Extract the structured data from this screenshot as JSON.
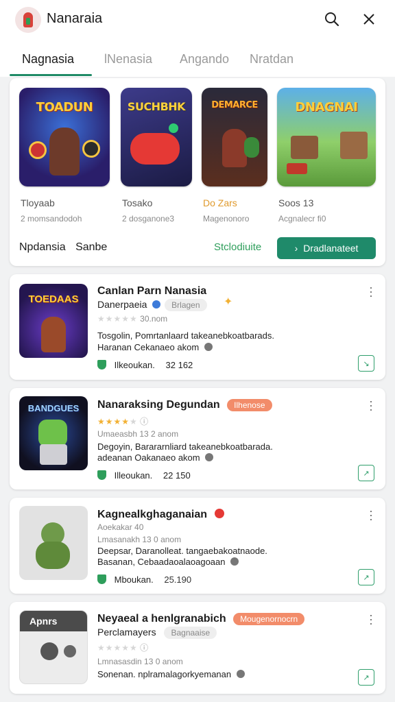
{
  "app": {
    "title": "Nanaraia"
  },
  "tabs": [
    {
      "label": "Nagnasia"
    },
    {
      "label": "lNenasia"
    },
    {
      "label": "Angando"
    },
    {
      "label": "Nratdan"
    }
  ],
  "featured": {
    "games": [
      {
        "art": "TOADUN",
        "name": "Tloyaab",
        "sub": "2 momsandodoh"
      },
      {
        "art": "SUCHBHK",
        "name": "Tosako",
        "sub": "2 dosganone3"
      },
      {
        "art": "DEMARCE",
        "name": "Do Zars",
        "sub": "Magenonoro"
      },
      {
        "art": "DNAGNAI",
        "name": "Soos 13",
        "sub": "Acgnalecr fi0"
      }
    ],
    "footer_a": "Npdansia",
    "footer_b": "Sanbe",
    "link": "Stclodiuite",
    "primary": "Dradlanateet"
  },
  "cards": [
    {
      "art": "TOEDAAS",
      "title": "Canlan Parn Nanasia",
      "subtitle": "Danerpaeia",
      "tag": "Brlagen",
      "meta": "30.nom",
      "desc1": "Tosgolin, Pomrtanlaard takeanebkoatbarads.",
      "desc2": "Haranan Cekanaeo akom",
      "stat": "Ilkeoukan.",
      "num": "32 162"
    },
    {
      "art": "BANDGUES",
      "title": "Nanaraksing Degundan",
      "subtitle": "",
      "tag": "Ilhenose",
      "meta": "Umaeasbh 13 2 anom",
      "desc1": "Degoyin, Barararnliard takeanebkoatbarada.",
      "desc2": "adeanan Oakanaeo akom",
      "stat": "Illeoukan.",
      "num": "22 150"
    },
    {
      "art": "",
      "title": "Kagnealkghaganaian",
      "subtitle": "Aoekakar 40",
      "tag": "",
      "meta": "Lmasanakh 13 0 anom",
      "desc1": "Deepsar, Daranolleat. tangaebakoatnaode.",
      "desc2": "Basanan, Cebaadaoalaoagoaan",
      "stat": "Mboukan.",
      "num": "25.190"
    },
    {
      "art": "Apnrs",
      "title": "Neyaeal a henlgranabich",
      "subtitle": "Perclamayers",
      "tag": "Bagnaaise",
      "tag2": "Mougenornocrn",
      "meta": "Lmnasasdin 13 0 anom",
      "desc1": "Sonenan. nplramalagorkyemanan",
      "desc2": "",
      "stat": "",
      "num": ""
    }
  ],
  "colors": {
    "accent": "#1f8a6a",
    "green": "#2e9e5b",
    "orange_badge": "#f28c6a",
    "star": "#f2b134"
  },
  "icons": [
    "search-icon",
    "close-icon",
    "more-icon",
    "shield-icon",
    "verified-icon",
    "arrow-right-icon"
  ]
}
